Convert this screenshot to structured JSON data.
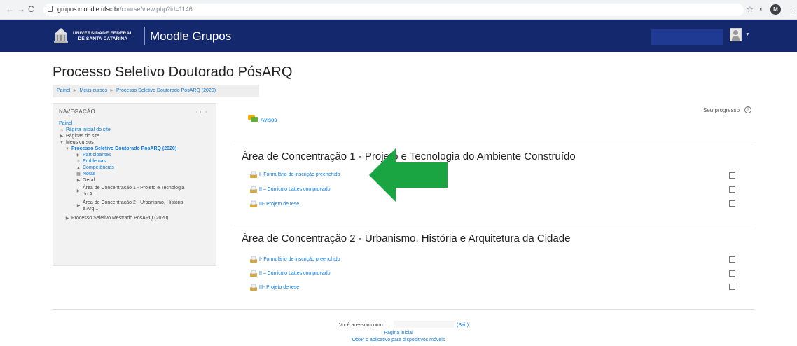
{
  "browser": {
    "url_host": "grupos.moodle.ufsc.br",
    "url_path": "/course/view.php?id=1146",
    "profile_initial": "M"
  },
  "navbar": {
    "university_line1": "UNIVERSIDADE FEDERAL",
    "university_line2": "DE SANTA CATARINA",
    "site_name": "Moodle Grupos"
  },
  "page": {
    "title": "Processo Seletivo Doutorado PósARQ",
    "breadcrumb": [
      "Painel",
      "Meus cursos",
      "Processo Seletivo Doutorado PósARQ (2020)"
    ]
  },
  "nav_block": {
    "heading": "NAVEGAÇÃO",
    "items": [
      {
        "label": "Painel"
      },
      {
        "label": "Página inicial do site"
      },
      {
        "label": "Páginas do site"
      },
      {
        "label": "Meus cursos"
      },
      {
        "label": "Processo Seletivo Doutorado PósARQ (2020)"
      },
      {
        "label": "Participantes"
      },
      {
        "label": "Emblemas"
      },
      {
        "label": "Competências"
      },
      {
        "label": "Notas"
      },
      {
        "label": "Geral"
      },
      {
        "label": "Área de Concentração 1 - Projeto e Tecnologia",
        "label2": "do A..."
      },
      {
        "label": "Área de Concentração 2 - Urbanismo, História",
        "label2": "e Arq..."
      },
      {
        "label": "Processo Seletivo Mestrado PósARQ (2020)"
      }
    ]
  },
  "main": {
    "announcements": "Avisos",
    "progress_label": "Seu progresso",
    "sections": [
      {
        "title": "Área de Concentração 1 - Projeto e Tecnologia do Ambiente Construído",
        "activities": [
          {
            "label": "I- Formulário de inscrição preenchido"
          },
          {
            "label": "II – Currículo Lattes comprovado"
          },
          {
            "label": "III- Projeto de tese"
          }
        ]
      },
      {
        "title": "Área de Concentração 2 - Urbanismo, História e Arquitetura da Cidade",
        "activities": [
          {
            "label": "I- Formulário de inscrição preenchido"
          },
          {
            "label": "II – Currículo Lattes comprovado"
          },
          {
            "label": "III- Projeto de tese"
          }
        ]
      }
    ]
  },
  "footer": {
    "logged_in_as": "Você acessou como",
    "logout": "(Sair)",
    "home": "Página inicial",
    "mobile_app": "Obter o aplicativo para dispositivos móveis"
  },
  "colors": {
    "navbar": "#14286e",
    "link": "#1177d1",
    "annotation_arrow": "#1aa542"
  }
}
